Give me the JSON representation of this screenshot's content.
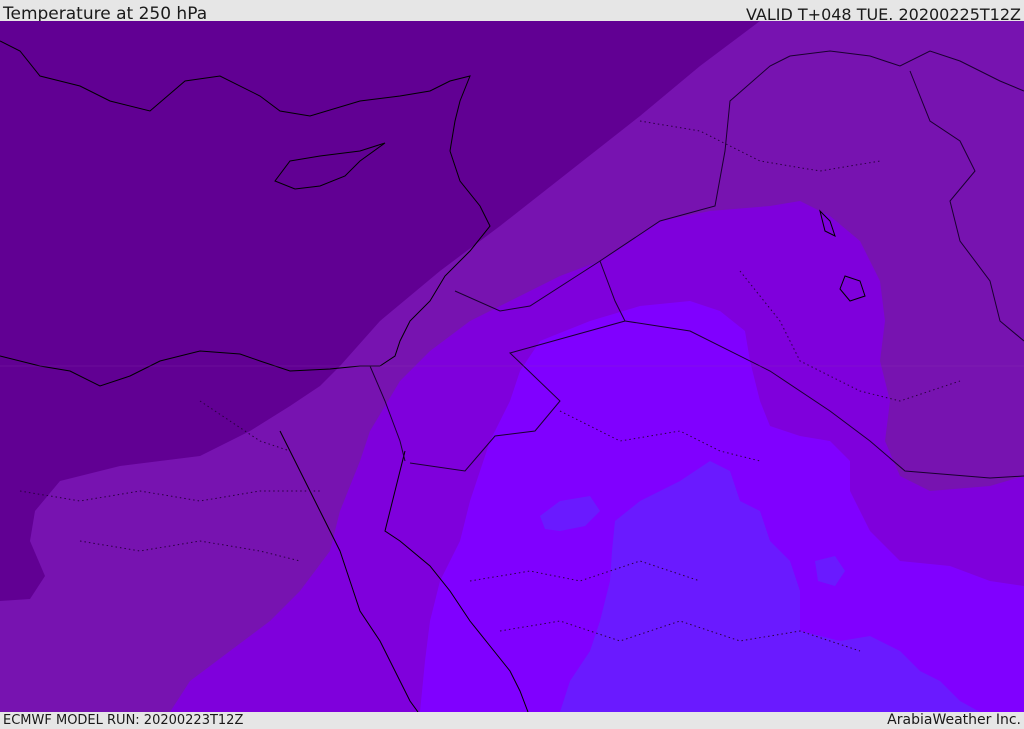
{
  "header": {
    "title": "Temperature at 250 hPa",
    "valid_time": "VALID T+048 TUE. 20200225T12Z"
  },
  "footer": {
    "model_run": "ECMWF MODEL RUN: 20200223T12Z",
    "credit": "ArabiaWeather Inc."
  },
  "map": {
    "variable": "temperature",
    "level": "250 hPa",
    "colors": {
      "coldest": "#610093",
      "cold": "#7713b0",
      "mid": "#7f00dc",
      "warm": "#8000ff",
      "warmest": "#6a1aff",
      "coast": "#000000",
      "border": "#2a0040"
    }
  }
}
